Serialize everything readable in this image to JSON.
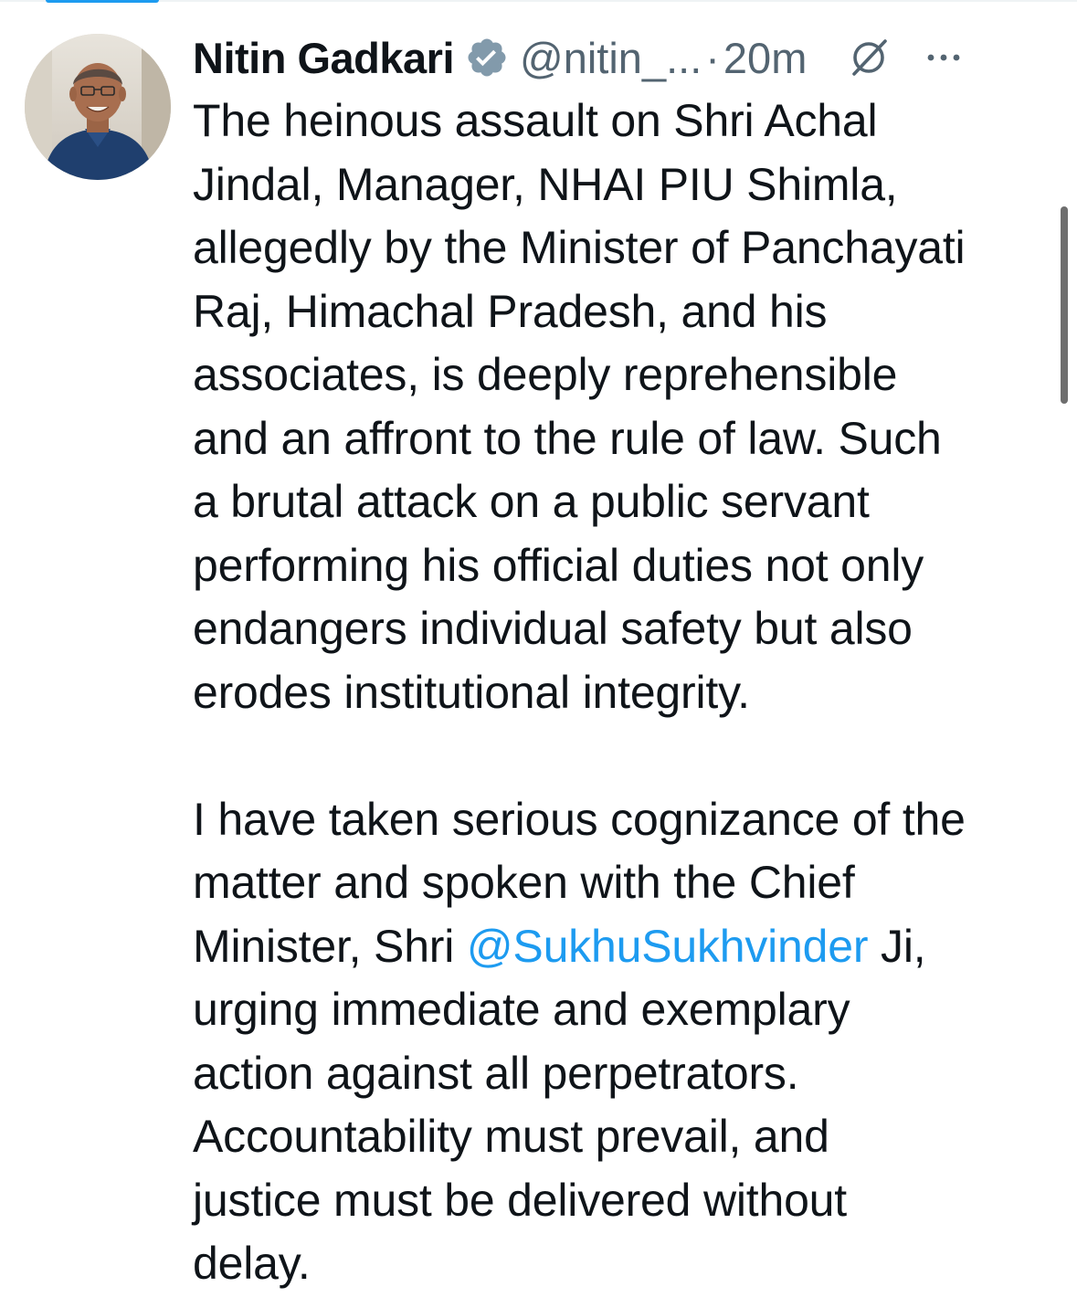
{
  "tweet": {
    "author_name": "Nitin Gadkari",
    "handle": "@nitin_...",
    "separator": "·",
    "time": "20m",
    "body_lines_1": [
      "The heinous assault on Shri Achal",
      "Jindal, Manager, NHAI PIU Shimla,",
      "allegedly by the Minister of Panchayati",
      "Raj, Himachal Pradesh, and his",
      "associates, is deeply reprehensible",
      "and an affront to the rule of law. Such",
      "a brutal attack on a public servant",
      "performing his official duties not only",
      "endangers individual safety but also",
      "erodes institutional integrity."
    ],
    "para2_line1": "I have taken serious cognizance of the",
    "para2_line2": "matter and spoken with the Chief",
    "para2_line3_prefix": "Minister, Shri ",
    "mention": "@SukhuSukhvinder",
    "para2_line3_suffix": " Ji,",
    "para2_rest": [
      "urging immediate and exemplary",
      "action against all perpetrators.",
      "Accountability must prevail, and",
      "justice must be delivered without",
      "delay."
    ]
  },
  "icons": {
    "verified": "verified-badge-icon",
    "grok": "grok-icon",
    "more": "more-options-icon"
  },
  "colors": {
    "text": "#0f1419",
    "secondary": "#536471",
    "link": "#1d9bf0",
    "verified_badge": "#829aab"
  }
}
